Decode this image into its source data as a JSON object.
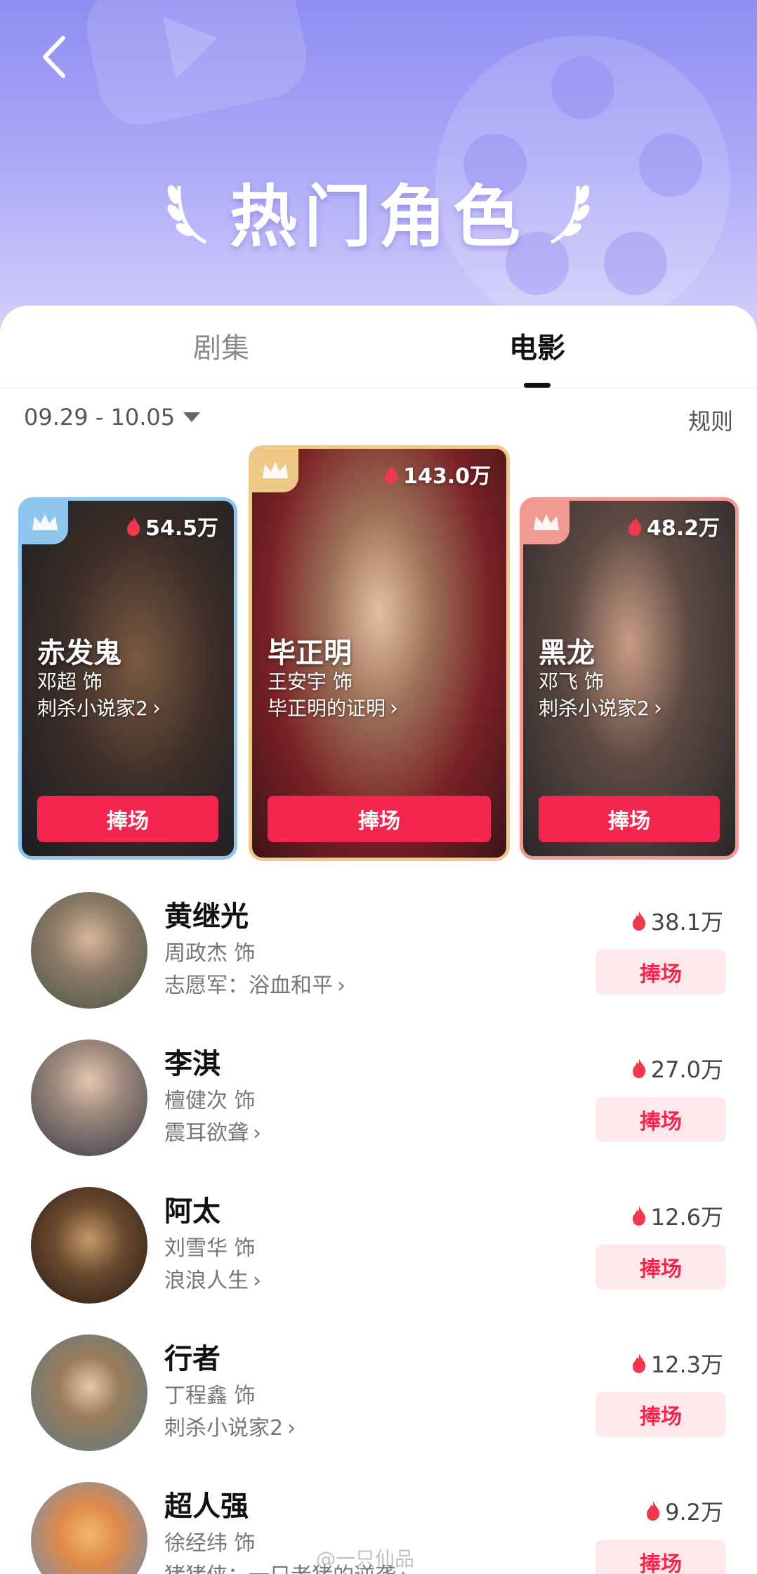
{
  "hero": {
    "title": "热门角色"
  },
  "tabs": [
    {
      "label": "剧集",
      "active": false
    },
    {
      "label": "电影",
      "active": true
    }
  ],
  "filters": {
    "date_range": "09.29 - 10.05",
    "rules_label": "规则"
  },
  "colors": {
    "accent": "#f2264f",
    "flame": "#f0394f",
    "gold": "#efc987",
    "blue": "#8fc6ef",
    "coral": "#f09a92"
  },
  "top_cards": [
    {
      "rank": 2,
      "heat": "54.5万",
      "role": "赤发鬼",
      "actor": "邓超 饰",
      "work": "刺杀小说家2",
      "button": "捧场",
      "badge_icon": "crown-icon"
    },
    {
      "rank": 1,
      "heat": "143.0万",
      "role": "毕正明",
      "actor": "王安宇 饰",
      "work": "毕正明的证明",
      "button": "捧场",
      "badge_icon": "crown-icon"
    },
    {
      "rank": 3,
      "heat": "48.2万",
      "role": "黑龙",
      "actor": "邓飞 饰",
      "work": "刺杀小说家2",
      "button": "捧场",
      "badge_icon": "crown-icon"
    }
  ],
  "list": [
    {
      "role": "黄继光",
      "actor": "周政杰 饰",
      "work": "志愿军：浴血和平",
      "heat": "38.1万",
      "button": "捧场"
    },
    {
      "role": "李淇",
      "actor": "檀健次 饰",
      "work": "震耳欲聋",
      "heat": "27.0万",
      "button": "捧场"
    },
    {
      "role": "阿太",
      "actor": "刘雪华 饰",
      "work": "浪浪人生",
      "heat": "12.6万",
      "button": "捧场"
    },
    {
      "role": "行者",
      "actor": "丁程鑫 饰",
      "work": "刺杀小说家2",
      "heat": "12.3万",
      "button": "捧场"
    },
    {
      "role": "超人强",
      "actor": "徐经纬 饰",
      "work": "猪猪侠：一只老猪的逆袭",
      "heat": "9.2万",
      "button": "捧场"
    }
  ],
  "watermark": "@一只仙品"
}
